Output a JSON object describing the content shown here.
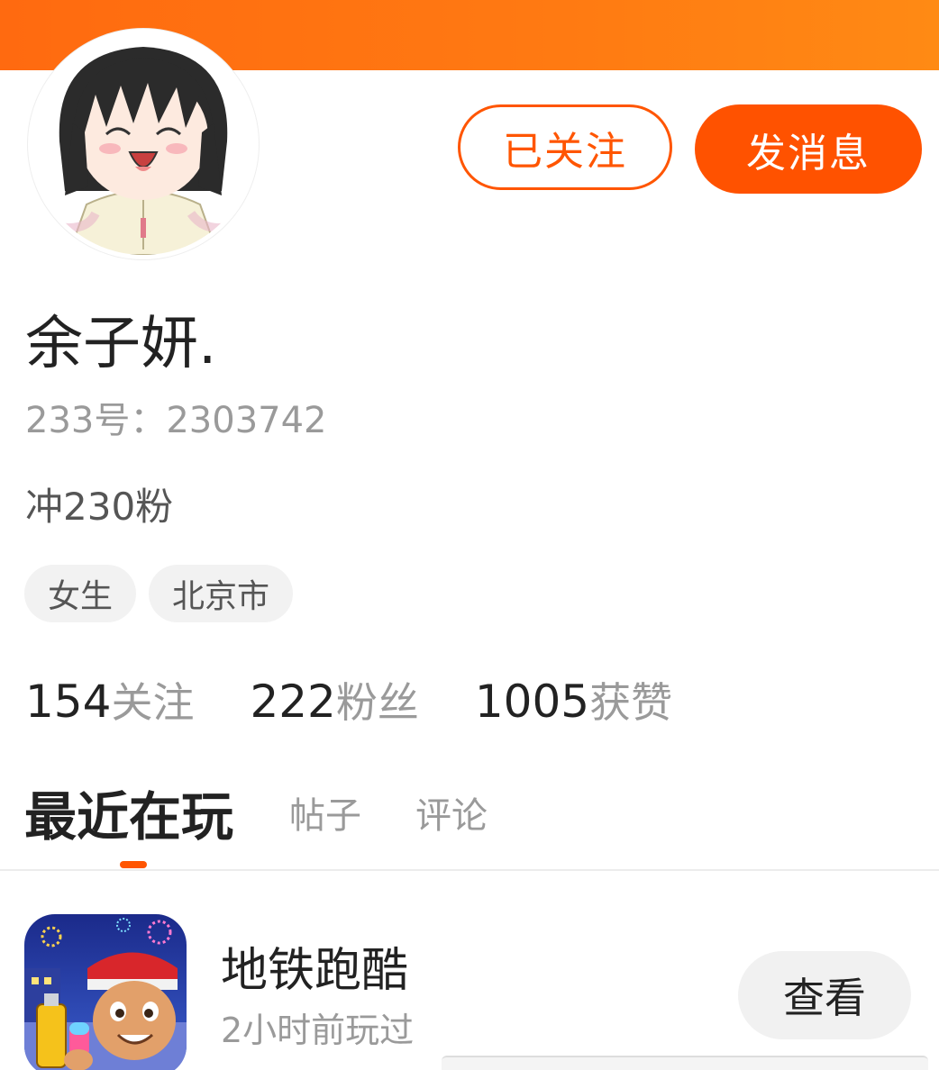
{
  "colors": {
    "accent": "#ff5500",
    "header_gradient_start": "#ff6a10",
    "header_gradient_end": "#ff8a14",
    "text_primary": "#222222",
    "text_secondary": "#9a9a9a",
    "tag_bg": "#f2f2f2"
  },
  "profile": {
    "avatar_icon": "avatar-anime-girl",
    "follow_button_label": "已关注",
    "message_button_label": "发消息",
    "username": "余子妍.",
    "user_id": "233号：2303742",
    "bio": "冲230粉",
    "tags": [
      "女生",
      "北京市"
    ]
  },
  "stats": [
    {
      "count": "154",
      "label": "关注"
    },
    {
      "count": "222",
      "label": "粉丝"
    },
    {
      "count": "1005",
      "label": "获赞"
    }
  ],
  "tabs": {
    "active": "最近在玩",
    "items": [
      "帖子",
      "评论"
    ]
  },
  "recent_games": [
    {
      "icon": "subway-surfers-icon",
      "name": "地铁跑酷",
      "played": "2小时前玩过",
      "button_label": "查看"
    }
  ]
}
